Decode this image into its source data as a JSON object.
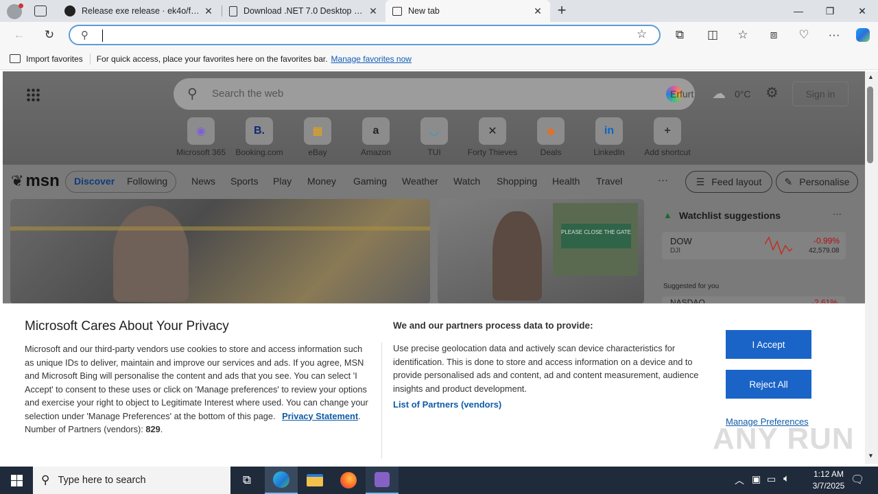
{
  "tabs": [
    {
      "title": "Release exe release · ek4o/fake-e",
      "icon": "github-icon"
    },
    {
      "title": "Download .NET 7.0 Desktop Runt",
      "icon": "document-icon"
    },
    {
      "title": "New tab",
      "icon": "newtab-icon"
    }
  ],
  "address": {
    "value": "",
    "placeholder": ""
  },
  "favorites_bar": {
    "import_label": "Import favorites",
    "hint": "For quick access, place your favorites here on the favorites bar.",
    "manage_link": "Manage favorites now"
  },
  "msn": {
    "search_placeholder": "Search the web",
    "location": "Erfurt",
    "temperature": "0°C",
    "sign_in": "Sign in",
    "shortcuts": [
      {
        "label": "Microsoft 365",
        "glyph": "◉",
        "color": "#7b5fd8"
      },
      {
        "label": "Booking.com",
        "glyph": "B.",
        "color": "#0b2a6f"
      },
      {
        "label": "eBay",
        "glyph": "▦",
        "color": "#e8a317"
      },
      {
        "label": "Amazon",
        "glyph": "a",
        "color": "#222222"
      },
      {
        "label": "TUI",
        "glyph": "◡",
        "color": "#1a9fe0"
      },
      {
        "label": "Forty Thieves",
        "glyph": "✕",
        "color": "#222222"
      },
      {
        "label": "Deals",
        "glyph": "◆",
        "color": "#e0702a"
      },
      {
        "label": "LinkedIn",
        "glyph": "in",
        "color": "#0a66c2"
      },
      {
        "label": "Add shortcut",
        "glyph": "+",
        "color": "#333333"
      }
    ],
    "brand": "msn",
    "tabs": [
      "Discover",
      "Following"
    ],
    "nav": [
      "News",
      "Sports",
      "Play",
      "Money",
      "Gaming",
      "Weather",
      "Watch",
      "Shopping",
      "Health",
      "Travel"
    ],
    "more": "···",
    "feed_layout": "Feed layout",
    "personalise": "Personalise",
    "watchlist": {
      "title": "Watchlist suggestions",
      "more": "···",
      "stock": {
        "name": "DOW",
        "sub": "DJI",
        "change": "-0.99%",
        "value": "42,579.08"
      },
      "suggested": "Suggested for you",
      "next": {
        "name": "NASDAQ",
        "change": "-2.61%"
      }
    }
  },
  "privacy": {
    "title": "Microsoft Cares About Your Privacy",
    "body": "Microsoft and our third-party vendors use cookies to store and access information such as unique IDs to deliver, maintain and improve our services and ads. If you agree, MSN and Microsoft Bing will personalise the content and ads that you see. You can select 'I Accept' to consent to these uses or click on 'Manage preferences' to review your options and exercise your right to object to Legitimate Interest where used.  You can change your selection under 'Manage Preferences' at the bottom of this page.",
    "privacy_link": "Privacy Statement",
    "partners_label": "Number of Partners (vendors):",
    "partners_count": "829",
    "right_title": "We and our partners process data to provide:",
    "right_body": "Use precise geolocation data and actively scan device characteristics for identification. This is done to store and access information on a device and to provide personalised ads and content, ad and content measurement, audience insights and product development.",
    "partners_link": "List of Partners (vendors)",
    "accept": "I Accept",
    "reject": "Reject All",
    "manage": "Manage Preferences"
  },
  "watermark": "ANY RUN",
  "taskbar": {
    "search_placeholder": "Type here to search",
    "time": "1:12 AM",
    "date": "3/7/2025"
  },
  "colors": {
    "accent": "#1a64c8",
    "link": "#0f5ba7",
    "taskbar": "#1f2a3a"
  }
}
